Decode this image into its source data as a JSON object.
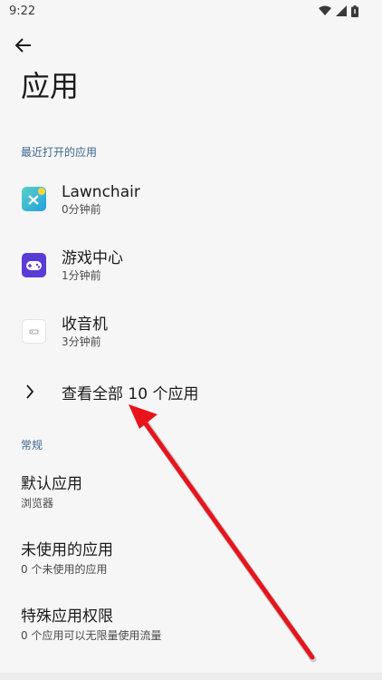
{
  "status_bar": {
    "time": "9:22"
  },
  "header": {
    "title": "应用"
  },
  "recent": {
    "section_label": "最近打开的应用",
    "apps": [
      {
        "name": "Lawnchair",
        "subtitle": "0分钟前",
        "icon": "lawnchair-icon",
        "color": "#2fbf9f"
      },
      {
        "name": "游戏中心",
        "subtitle": "1分钟前",
        "icon": "gamepad-icon",
        "color": "#5b3bd6"
      },
      {
        "name": "收音机",
        "subtitle": "3分钟前",
        "icon": "radio-icon",
        "color": "#ffffff"
      }
    ],
    "see_all_label": "查看全部 10 个应用"
  },
  "general": {
    "section_label": "常规",
    "items": [
      {
        "title": "默认应用",
        "subtitle": "浏览器"
      },
      {
        "title": "未使用的应用",
        "subtitle": "0 个未使用的应用"
      },
      {
        "title": "特殊应用权限",
        "subtitle": "0 个应用可以无限量使用流量"
      }
    ]
  },
  "colors": {
    "accent": "#3c6690",
    "annotation": "#e8141c",
    "background": "#f6f6f6"
  }
}
